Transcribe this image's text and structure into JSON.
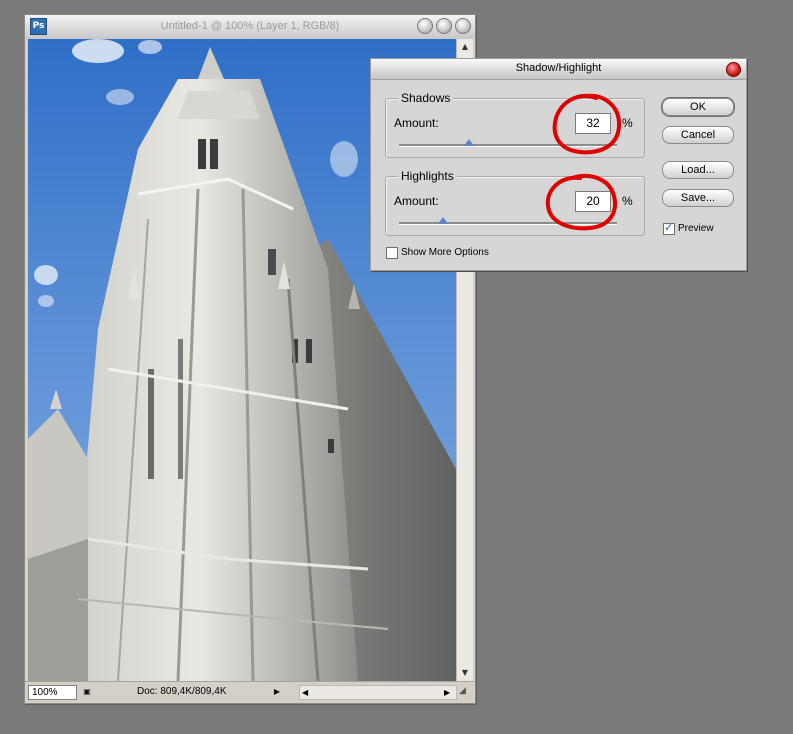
{
  "document_window": {
    "title": "Untitled-1 @ 100% (Layer 1, RGB/8)",
    "zoom": "100%",
    "doc_info": "Doc: 809,4K/809,4K"
  },
  "dialog": {
    "title": "Shadow/Highlight",
    "shadows": {
      "group_label": "Shadows",
      "amount_label": "Amount:",
      "amount_value": "32",
      "unit": "%",
      "slider_fraction": 0.32
    },
    "highlights": {
      "group_label": "Highlights",
      "amount_label": "Amount:",
      "amount_value": "20",
      "unit": "%",
      "slider_fraction": 0.2
    },
    "show_more_options": "Show More Options",
    "buttons": {
      "ok": "OK",
      "cancel": "Cancel",
      "load": "Load...",
      "save": "Save..."
    },
    "preview": {
      "label": "Preview",
      "checked": true
    }
  },
  "colors": {
    "annotation": "#e00000",
    "sky": "#3f78cc",
    "slider_thumb": "#5b86c6"
  }
}
